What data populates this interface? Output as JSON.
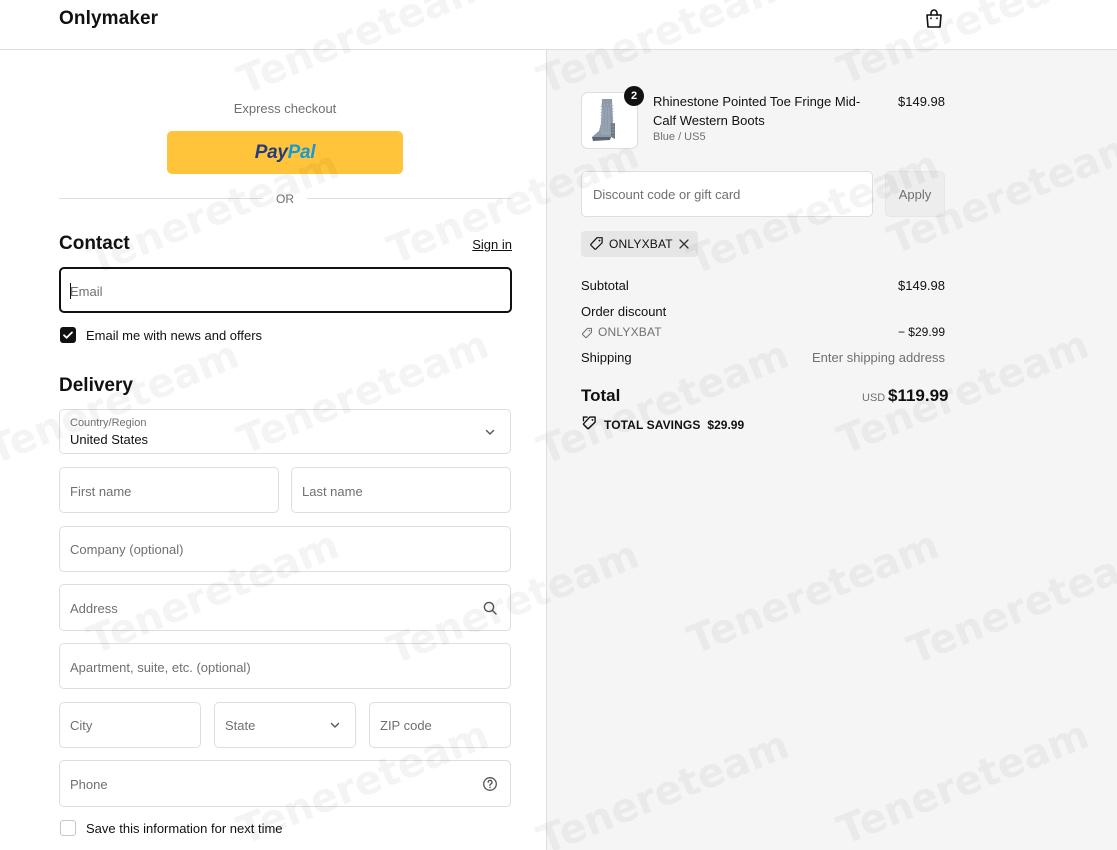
{
  "header": {
    "brand": "Onlymaker",
    "cart_icon": "shopping-bag-icon"
  },
  "express": {
    "label": "Express checkout",
    "paypal_pay": "Pay",
    "paypal_pal": "Pal",
    "or": "OR"
  },
  "contact": {
    "title": "Contact",
    "signin": "Sign in",
    "email_placeholder": "Email",
    "newsletter_label": "Email me with news and offers",
    "newsletter_checked": true
  },
  "delivery": {
    "title": "Delivery",
    "country_label": "Country/Region",
    "country_value": "United States",
    "first_name": "First name",
    "last_name": "Last name",
    "company": "Company (optional)",
    "address": "Address",
    "apartment": "Apartment, suite, etc. (optional)",
    "city": "City",
    "state": "State",
    "zip": "ZIP code",
    "phone": "Phone",
    "save_info_label": "Save this information for next time",
    "save_info_checked": false
  },
  "order": {
    "product": {
      "name": "Rhinestone Pointed Toe Fringe Mid-Calf Western Boots",
      "variant": "Blue / US5",
      "price": "$149.98",
      "quantity": "2"
    },
    "discount_placeholder": "Discount code or gift card",
    "apply": "Apply",
    "applied_code": "ONLYXBAT",
    "subtotal_label": "Subtotal",
    "subtotal_value": "$149.98",
    "order_discount_label": "Order discount",
    "order_discount_code": "ONLYXBAT",
    "order_discount_value": "− $29.99",
    "shipping_label": "Shipping",
    "shipping_value": "Enter shipping address",
    "total_label": "Total",
    "total_currency": "USD",
    "total_value": "$119.99",
    "savings_label": "TOTAL SAVINGS",
    "savings_value": "$29.99"
  },
  "watermark": "Tenereteam",
  "colors": {
    "paypal_yellow": "#ffc439",
    "paypal_dark_blue": "#253b80",
    "paypal_light_blue": "#179bd7",
    "border": "#dedede",
    "muted_text": "#707070",
    "summary_bg": "#f5f5f5"
  }
}
